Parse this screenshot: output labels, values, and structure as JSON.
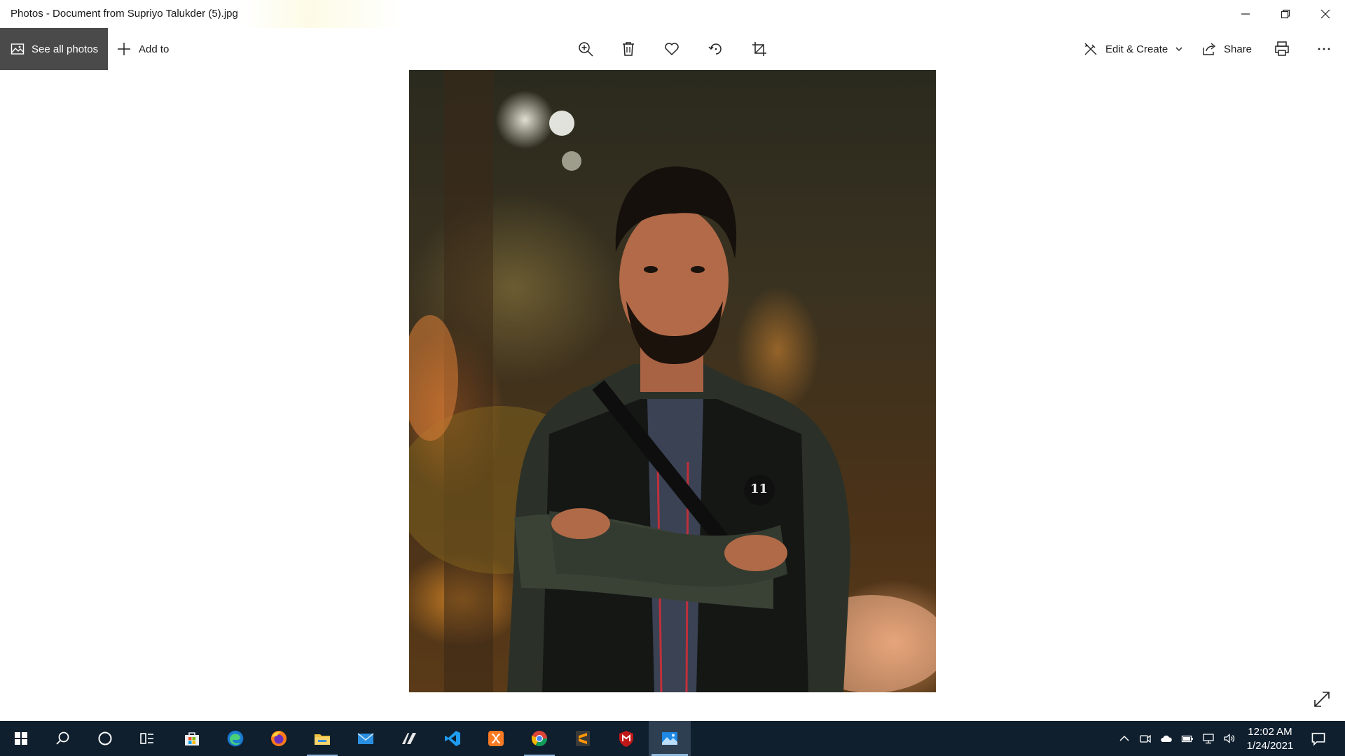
{
  "window": {
    "title": "Photos - Document from Supriyo Talukder (5).jpg"
  },
  "toolbar": {
    "see_all_label": "See all photos",
    "add_to_label": "Add to",
    "edit_create_label": "Edit & Create",
    "share_label": "Share"
  },
  "photo": {
    "jersey_number": "11"
  },
  "taskbar": {
    "time": "12:02 AM",
    "date": "1/24/2021",
    "apps": [
      "start",
      "search",
      "cortana",
      "task-view",
      "microsoft-store",
      "edge",
      "firefox",
      "file-explorer",
      "mail",
      "autodesk",
      "vscode",
      "xampp",
      "chrome",
      "sublime-text",
      "mcafee",
      "photos"
    ]
  },
  "colors": {
    "taskbar_bg": "#0f1f2e",
    "see_all_bg": "#4a4a4a",
    "accent": "#8fb5d9"
  }
}
